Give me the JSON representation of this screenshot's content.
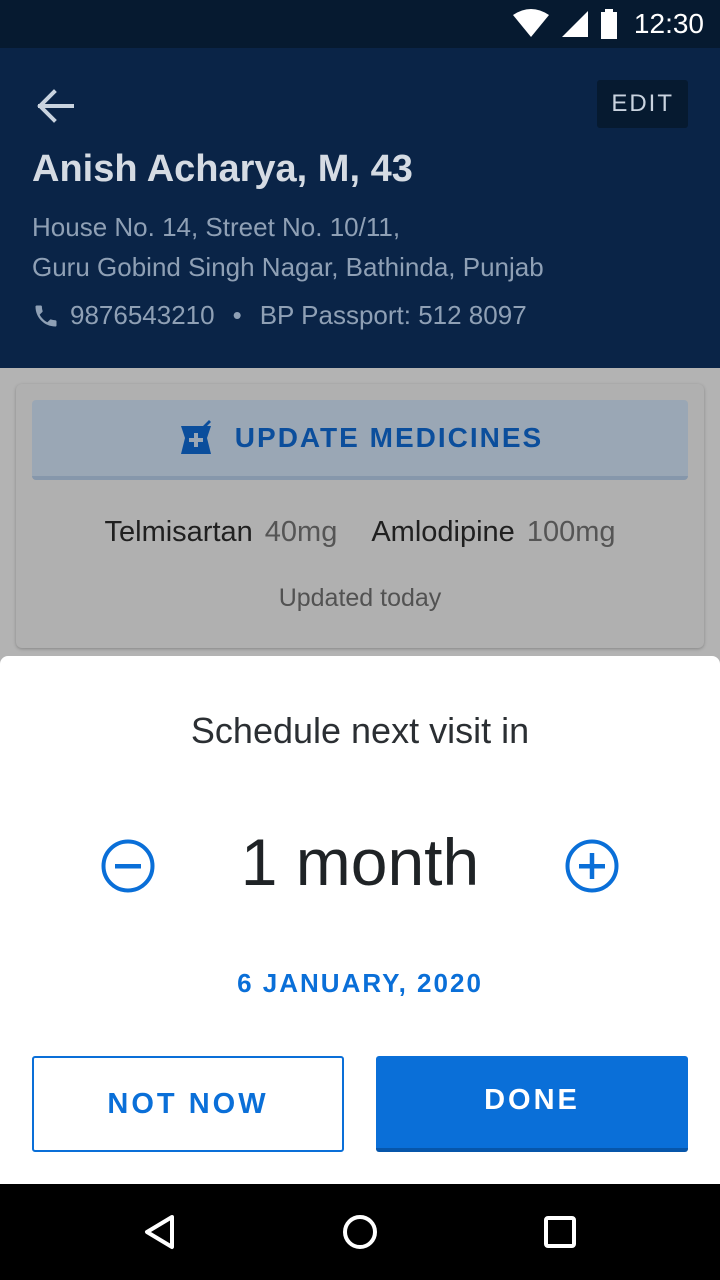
{
  "status_bar": {
    "time": "12:30",
    "icons": [
      "wifi-icon",
      "signal-icon",
      "battery-icon"
    ]
  },
  "header": {
    "edit_label": "EDIT",
    "patient_name": "Anish Acharya, M, 43",
    "address_line1": "House No. 14, Street No. 10/11,",
    "address_line2": "Guru Gobind Singh Nagar, Bathinda, Punjab",
    "phone": "9876543210",
    "separator": "•",
    "bp_passport": "BP Passport: 512 8097"
  },
  "medicines": {
    "update_label": "UPDATE MEDICINES",
    "items": [
      {
        "name": "Telmisartan",
        "dose": "40mg"
      },
      {
        "name": "Amlodipine",
        "dose": "100mg"
      }
    ],
    "updated_text": "Updated today"
  },
  "sheet": {
    "title": "Schedule next visit in",
    "duration": "1 month",
    "date": "6 JANUARY, 2020",
    "not_now_label": "NOT NOW",
    "done_label": "DONE"
  },
  "colors": {
    "header_bg": "#0a2447",
    "status_bg": "#061a30",
    "accent": "#0a6fd8",
    "scrim_gray": "#b3b3b3"
  }
}
